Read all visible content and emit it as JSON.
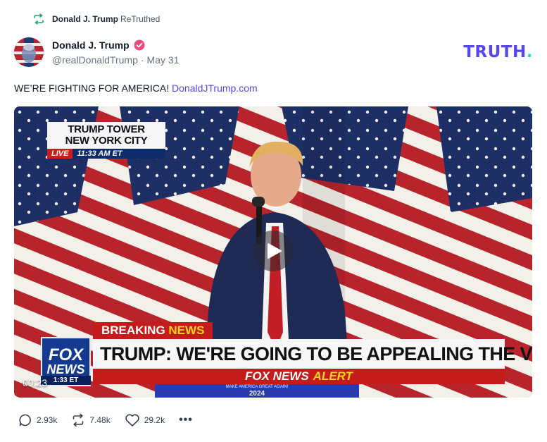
{
  "retruth": {
    "name": "Donald J. Trump",
    "action": "ReTruthed",
    "icon": "retruth-icon"
  },
  "author": {
    "display_name": "Donald J. Trump",
    "handle": "@realDonaldTrump",
    "date": "May 31",
    "verified_icon": "verified-badge-icon",
    "verified_color": "#ec4a7d"
  },
  "brand": {
    "logo_text": "TRUTH",
    "logo_dot": ".",
    "color": "#5448ee",
    "dot_color": "#17e6c6"
  },
  "post": {
    "text": "WE’RE FIGHTING FOR AMERICA!",
    "link": "DonaldJTrump.com"
  },
  "video": {
    "location_line1": "TRUMP TOWER",
    "location_line2": "NEW YORK CITY",
    "live_tag": "LIVE",
    "live_time": "11:33 AM ET",
    "breaking_prefix": "BREAKING",
    "breaking_suffix": "NEWS",
    "headline": "TRUMP: WE'RE GOING TO BE APPEALING THE VERDICT",
    "network_logo_line1": "FOX",
    "network_logo_line2": "NEWS",
    "network_time": "1:33 ET",
    "alert_prefix": "FOX NEWS",
    "alert_suffix": "ALERT",
    "podium_small": "MAKE AMERICA GREAT AGAIN!",
    "podium_year": "2024",
    "duration": "00:23",
    "play_icon": "play-icon"
  },
  "actions": {
    "replies": "2.93k",
    "retruths": "7.48k",
    "likes": "29.2k",
    "more": "•••"
  }
}
